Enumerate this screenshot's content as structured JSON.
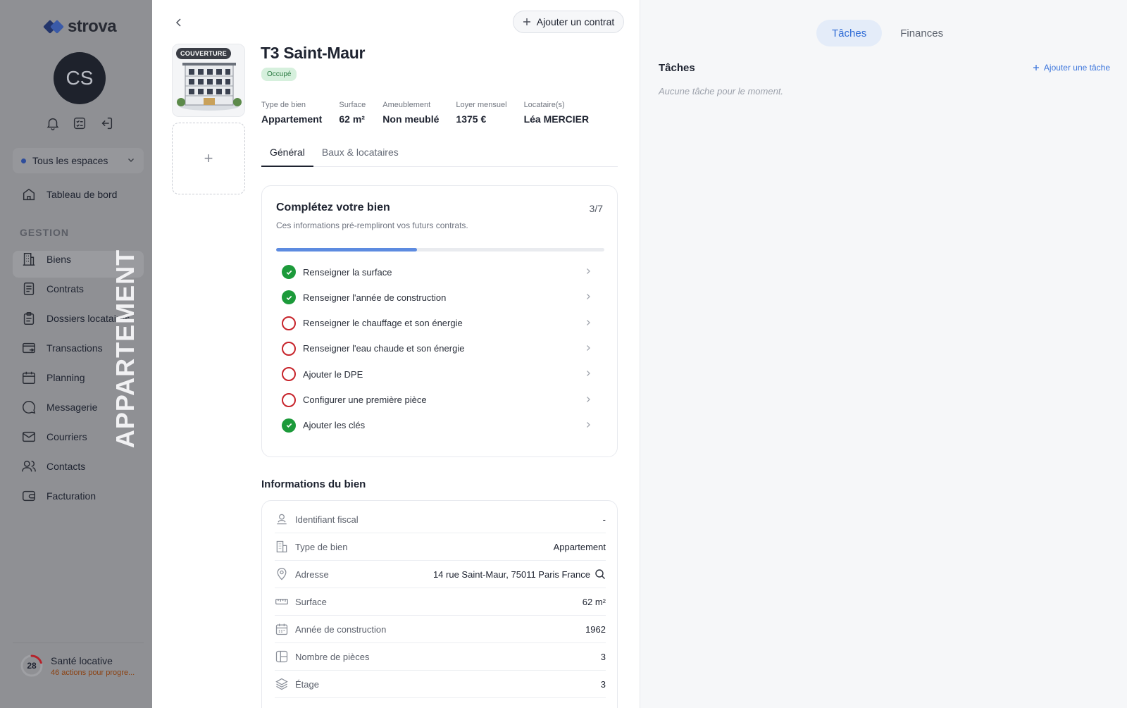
{
  "sidebar": {
    "logo": "strova",
    "avatar_initials": "CS",
    "space_selector": "Tous les espaces",
    "dashboard": "Tableau de bord",
    "section_label": "GESTION",
    "items": [
      {
        "label": "Biens",
        "icon": "building-icon"
      },
      {
        "label": "Contrats",
        "icon": "document-icon"
      },
      {
        "label": "Dossiers locataires",
        "icon": "clipboard-icon"
      },
      {
        "label": "Transactions",
        "icon": "wallet-transfer-icon"
      },
      {
        "label": "Planning",
        "icon": "calendar-icon"
      },
      {
        "label": "Messagerie",
        "icon": "chat-icon"
      },
      {
        "label": "Courriers",
        "icon": "mail-icon"
      },
      {
        "label": "Contacts",
        "icon": "contacts-icon"
      },
      {
        "label": "Facturation",
        "icon": "billing-icon"
      }
    ],
    "watermark": "APPARTEMENT",
    "health": {
      "score": "28",
      "title": "Santé locative",
      "subtitle": "46 actions pour progre..."
    }
  },
  "property": {
    "add_contract": "Ajouter un contrat",
    "cover_badge": "COUVERTURE",
    "add_photo": "+",
    "title": "T3 Saint-Maur",
    "status": "Occupé",
    "facts": [
      {
        "label": "Type de bien",
        "value": "Appartement"
      },
      {
        "label": "Surface",
        "value": "62 m²"
      },
      {
        "label": "Ameublement",
        "value": "Non meublé"
      },
      {
        "label": "Loyer mensuel",
        "value": "1375 €"
      },
      {
        "label": "Locataire(s)",
        "value": "Léa MERCIER"
      }
    ],
    "tabs": [
      "Général",
      "Baux & locataires"
    ]
  },
  "completion": {
    "title": "Complétez votre bien",
    "count": "3/7",
    "subtitle": "Ces informations pré-rempliront vos futurs contrats.",
    "progress": 0.43,
    "items": [
      {
        "label": "Renseigner la surface",
        "done": true
      },
      {
        "label": "Renseigner l'année de construction",
        "done": true
      },
      {
        "label": "Renseigner le chauffage et son énergie",
        "done": false
      },
      {
        "label": "Renseigner l'eau chaude et son énergie",
        "done": false
      },
      {
        "label": "Ajouter le DPE",
        "done": false
      },
      {
        "label": "Configurer une première pièce",
        "done": false
      },
      {
        "label": "Ajouter les clés",
        "done": true
      }
    ]
  },
  "info": {
    "title": "Informations du bien",
    "rows": [
      {
        "label": "Identifiant fiscal",
        "value": "-",
        "icon": "fiscal-id-icon"
      },
      {
        "label": "Type de bien",
        "value": "Appartement",
        "icon": "building-type-icon"
      },
      {
        "label": "Adresse",
        "value": "14 rue Saint-Maur, 75011 Paris France",
        "icon": "location-pin-icon"
      },
      {
        "label": "Surface",
        "value": "62 m²",
        "icon": "ruler-icon"
      },
      {
        "label": "Année de construction",
        "value": "1962",
        "icon": "calendar-icon"
      },
      {
        "label": "Nombre de pièces",
        "value": "3",
        "icon": "rooms-icon"
      },
      {
        "label": "Étage",
        "value": "3",
        "icon": "layers-icon"
      }
    ]
  },
  "right_panel": {
    "tabs": [
      "Tâches",
      "Finances"
    ],
    "active_tab": "Tâches",
    "tasks_title": "Tâches",
    "add_task": "Ajouter une tâche",
    "empty": "Aucune tâche pour le moment."
  }
}
